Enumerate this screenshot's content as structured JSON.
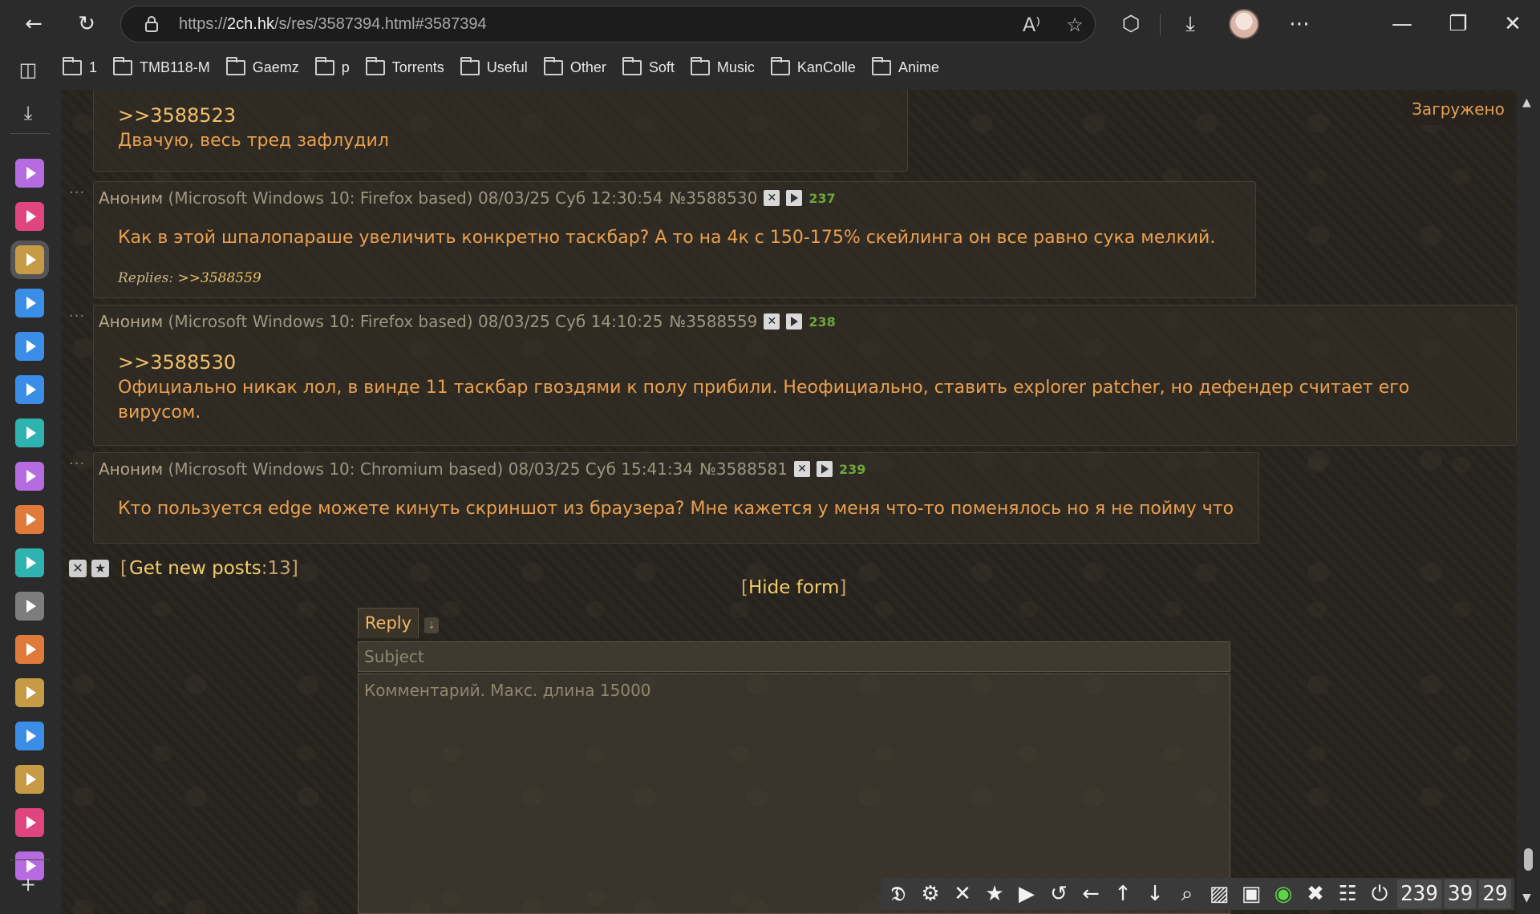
{
  "browser": {
    "url_prefix": "https://",
    "url_host": "2ch.hk",
    "url_path": "/s/res/3587394.html#3587394",
    "bookmarks": [
      "1",
      "TMB118-M",
      "Gaemz",
      "p",
      "Torrents",
      "Useful",
      "Other",
      "Soft",
      "Music",
      "KanColle",
      "Anime"
    ],
    "sidebar_tile_colors": [
      "#b66be0",
      "#e0457f",
      "#c79b45",
      "#3b8ee8",
      "#3b8ee8",
      "#3b8ee8",
      "#2fb3b0",
      "#b66be0",
      "#e07a3b",
      "#2fb3b0",
      "#7d7d7d",
      "#e07a3b",
      "#c79b45",
      "#3b8ee8",
      "#c79b45",
      "#e0457f",
      "#b66be0"
    ]
  },
  "page": {
    "loaded_label": "Загружено",
    "prev_post": {
      "reply_link": ">>3588523",
      "text": "Двачую, весь тред зафлудил"
    },
    "posts": [
      {
        "name": "Аноним",
        "platform": "(Microsoft Windows 10: Firefox based)",
        "date": "08/03/25 Суб 12:30:54",
        "number": "№3588530",
        "count": "237",
        "reply_link": "",
        "lines": [
          "Как в этой шпалопараше увеличить конкретно таскбар? А то на 4к с 150-175% скейлинга он все равно сука мелкий."
        ],
        "replies_label": "Replies:",
        "replies": ">>3588559"
      },
      {
        "name": "Аноним",
        "platform": "(Microsoft Windows 10: Firefox based)",
        "date": "08/03/25 Суб 14:10:25",
        "number": "№3588559",
        "count": "238",
        "reply_link": ">>3588530",
        "lines": [
          "Официально никак лол, в винде 11 таскбар гвоздями к полу прибили. Неофициально, ставить explorer patcher, но дефендер считает его",
          "вирусом."
        ],
        "replies_label": "",
        "replies": ""
      },
      {
        "name": "Аноним",
        "platform": "(Microsoft Windows 10: Chromium based)",
        "date": "08/03/25 Суб 15:41:34",
        "number": "№3588581",
        "count": "239",
        "reply_link": "",
        "lines": [
          "Кто пользуется edge можете кинуть скриншот из браузера? Мне кажется у меня что-то поменялось но я не пойму что"
        ],
        "replies_label": "",
        "replies": ""
      }
    ],
    "get_new": {
      "open": "[",
      "label": "Get new posts",
      "sep": ": ",
      "count": "13",
      "close": "]"
    },
    "hide_form": {
      "open": "[",
      "label": "Hide form",
      "close": "]"
    },
    "form": {
      "reply_tab": "Reply",
      "subject_placeholder": "Subject",
      "comment_placeholder": "Комментарий. Макс. длина 15000"
    },
    "toolbar": {
      "icons": [
        "settings-icon",
        "close-icon",
        "star-icon",
        "play-icon",
        "refresh-icon",
        "arrow-left-icon",
        "arrow-up-icon",
        "arrow-down-icon",
        "zoom-icon",
        "hatch-icon",
        "save-icon",
        "eye-icon",
        "mute-icon",
        "grid-icon",
        "power-icon"
      ],
      "counter_posts": "239",
      "counter_files": "39",
      "counter_posters": "29"
    }
  }
}
